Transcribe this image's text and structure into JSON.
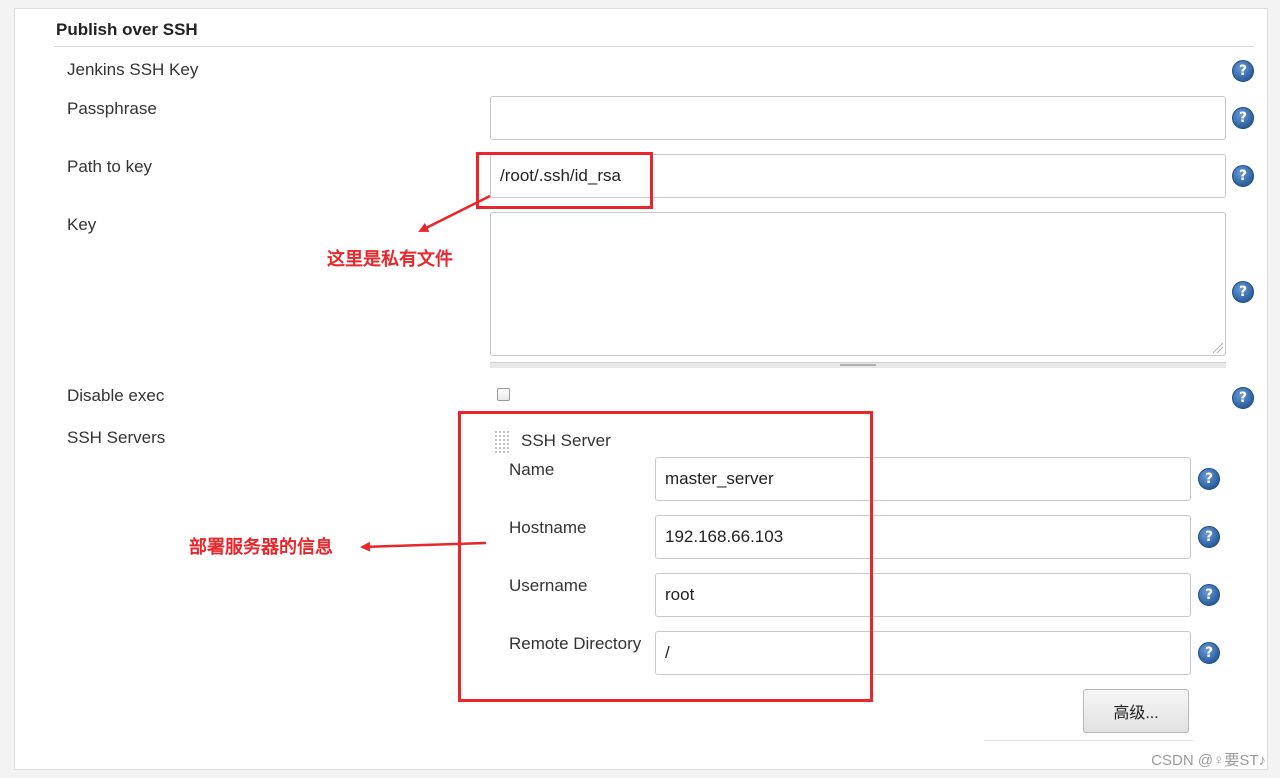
{
  "section": {
    "title": "Publish over SSH"
  },
  "fields": {
    "jenkins_ssh_key": {
      "label": "Jenkins SSH Key"
    },
    "passphrase": {
      "label": "Passphrase",
      "value": ""
    },
    "path_to_key": {
      "label": "Path to key",
      "value": "/root/.ssh/id_rsa"
    },
    "key": {
      "label": "Key",
      "value": ""
    },
    "disable_exec": {
      "label": "Disable exec",
      "checked": false
    },
    "ssh_servers": {
      "label": "SSH Servers"
    }
  },
  "ssh_server": {
    "title": "SSH Server",
    "name": {
      "label": "Name",
      "value": "master_server"
    },
    "hostname": {
      "label": "Hostname",
      "value": "192.168.66.103"
    },
    "username": {
      "label": "Username",
      "value": "root"
    },
    "remote_directory": {
      "label": "Remote Directory",
      "value": "/"
    },
    "advanced_label": "高级..."
  },
  "annotations": {
    "private_file": "这里是私有文件",
    "server_info": "部署服务器的信息"
  },
  "help_glyph": "?",
  "watermark": "CSDN @♀要ST♪",
  "colors": {
    "annotation_red": "#e8262b",
    "help_blue": "#2a5f9e"
  }
}
